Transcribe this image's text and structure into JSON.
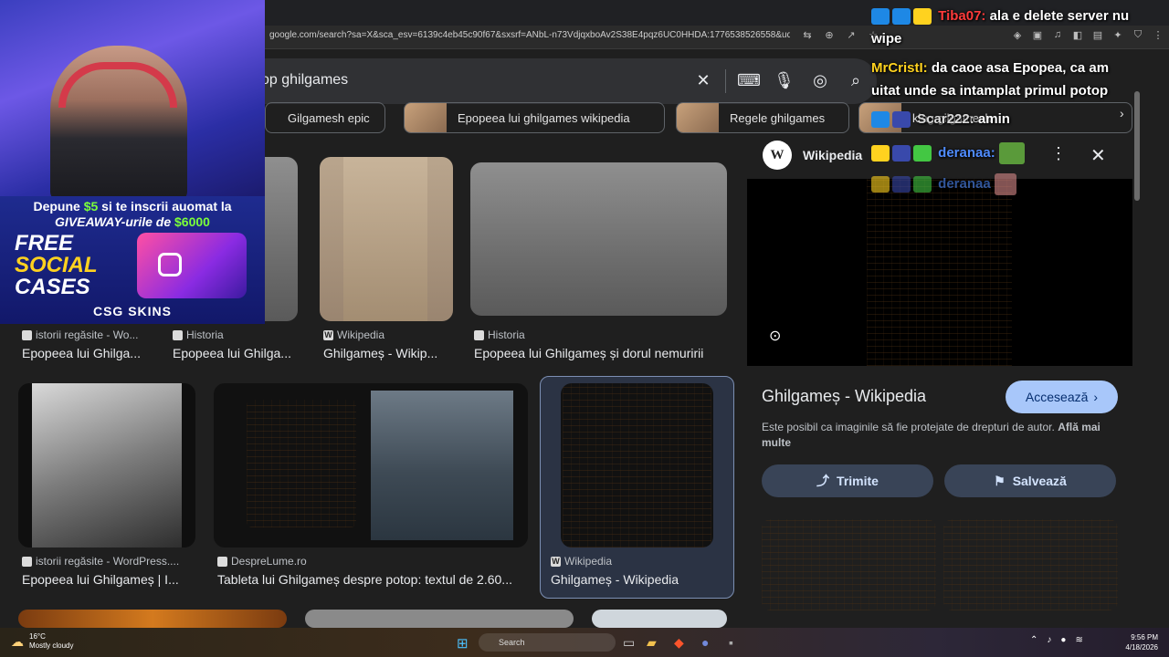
{
  "browser": {
    "url": "google.com/search?sa=X&sca_esv=6139c4eb45c90f67&sxsrf=ANbL-n73VdjqxboAv2S38E4pqz6UC0HHDA:1776538526558&udm=2&fbs=..."
  },
  "search": {
    "query": "op ghilgames"
  },
  "chips": [
    {
      "label": "Gilgamesh epic"
    },
    {
      "label": "Epopeea lui ghilgames wikipedia"
    },
    {
      "label": "Regele ghilgames"
    },
    {
      "label": "king gilgamesh"
    }
  ],
  "results": [
    {
      "source": "istorii regăsite - Wo...",
      "title": "Epopeea lui Ghilga..."
    },
    {
      "source": "Historia",
      "title": "Epopeea lui Ghilga..."
    },
    {
      "source": "Wikipedia",
      "title": "Ghilgameș - Wikip..."
    },
    {
      "source": "Historia",
      "title": "Epopeea lui Ghilgameș și dorul nemuririi"
    },
    {
      "source": "istorii regăsite - WordPress....",
      "title": "Epopeea lui Ghilgameș | I..."
    },
    {
      "source": "DespreLume.ro",
      "title": "Tableta lui Ghilgameș despre potop: textul de 2.60..."
    },
    {
      "source": "Wikipedia",
      "title": "Ghilgameș - Wikipedia"
    }
  ],
  "panel": {
    "site": "Wikipedia",
    "title": "Ghilgameș - Wikipedia",
    "visit_label": "Accesează",
    "notice": "Este posibil ca imaginile să fie protejate de drepturi de autor.",
    "notice_link": "Află mai multe",
    "share_label": "Trimite",
    "save_label": "Salvează"
  },
  "overlay": {
    "promo_line1_a": "Depune",
    "promo_amount1": "$5",
    "promo_line1_b": "si te inscrii auomat la",
    "promo_line2_a": "GIVEAWAY-urile de",
    "promo_amount2": "$6000",
    "free1": "FREE",
    "free2": "SOCIAL",
    "free3": "CASES",
    "brand": "CSG SKINS"
  },
  "chat": [
    {
      "user": "Tiba07:",
      "message": "ala e delete server nu"
    },
    {
      "user": "",
      "message": "wipe"
    },
    {
      "user": "MrCristI:",
      "message": "da caoe asa Epopea, ca am"
    },
    {
      "user": "",
      "message": "uitat unde sa intamplat primul potop"
    },
    {
      "user": "Scar222:",
      "message": "amin"
    },
    {
      "user": "deranaa:",
      "message": ""
    },
    {
      "user": "deranaa",
      "message": ""
    }
  ],
  "taskbar": {
    "temp": "16°C",
    "weather": "Mostly cloudy",
    "search_label": "Search",
    "time": "9:56 PM",
    "date": "4/18/2026"
  }
}
